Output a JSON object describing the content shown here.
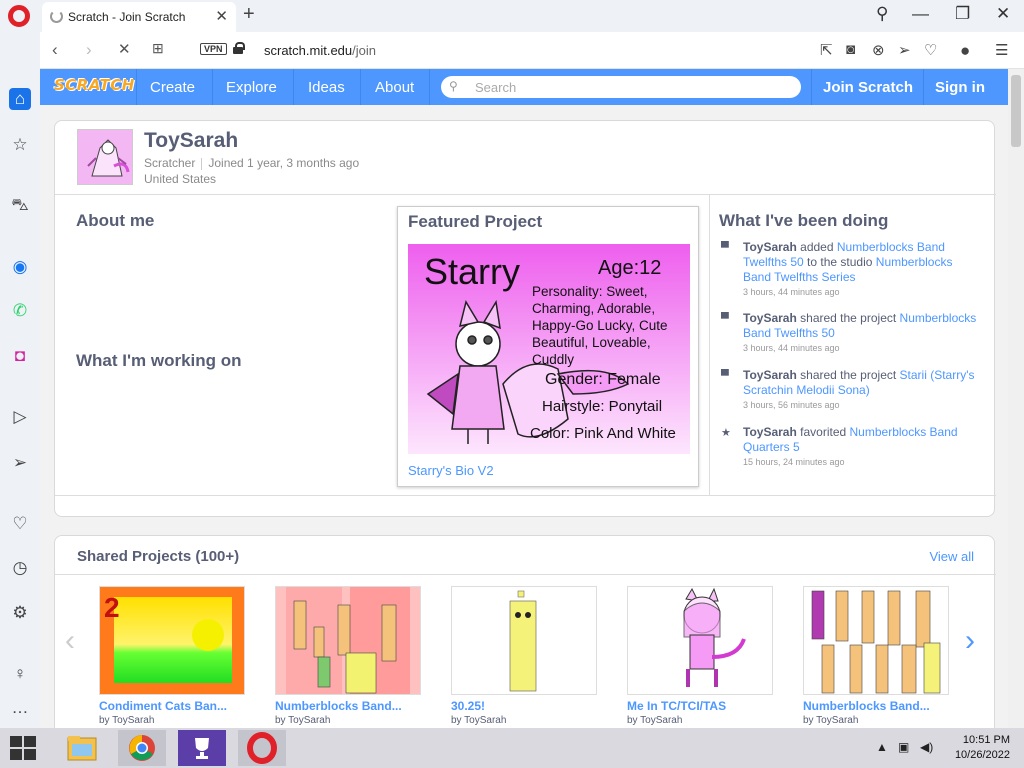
{
  "browser": {
    "tab_title": "Scratch - Join Scratch",
    "url_domain": "scratch.mit.edu",
    "url_path": "/join",
    "vpn_label": "VPN"
  },
  "scratch_nav": {
    "logo": "SCRATCH",
    "items": [
      "Create",
      "Explore",
      "Ideas",
      "About"
    ],
    "search_placeholder": "Search",
    "join": "Join Scratch",
    "signin": "Sign in"
  },
  "profile": {
    "username": "ToySarah",
    "role": "Scratcher",
    "joined": "Joined 1 year, 3 months ago",
    "country": "United States",
    "about_me_heading": "About me",
    "working_on_heading": "What I'm working on",
    "featured_heading": "Featured Project",
    "featured_title": "Starry's Bio V2",
    "featured_image": {
      "name": "Starry",
      "age": "Age:12",
      "personality": [
        "Personality: Sweet,",
        "Charming, Adorable,",
        "Happy-Go Lucky, Cute",
        "Beautiful, Loveable,",
        "Cuddly"
      ],
      "gender": "Gender: Female",
      "hairstyle": "Hairstyle: Ponytail",
      "color": "Color: Pink And White"
    },
    "activity_heading": "What I've been doing",
    "activity": [
      {
        "icon": "studio-icon",
        "user": "ToySarah",
        "verb": "added",
        "link1": "Numberblocks Band Twelfths 50",
        "mid": "to the studio",
        "link2": "Numberblocks Band Twelfths Series",
        "time": "3 hours, 44 minutes ago"
      },
      {
        "icon": "studio-icon",
        "user": "ToySarah",
        "verb": "shared the project",
        "link1": "Numberblocks Band Twelfths 50",
        "mid": "",
        "link2": "",
        "time": "3 hours, 44 minutes ago"
      },
      {
        "icon": "studio-icon",
        "user": "ToySarah",
        "verb": "shared the project",
        "link1": "Starii (Starry's Scratchin Melodii Sona)",
        "mid": "",
        "link2": "",
        "time": "3 hours, 56 minutes ago"
      },
      {
        "icon": "star-icon",
        "user": "ToySarah",
        "verb": "favorited",
        "link1": "Numberblocks Band Quarters 5",
        "mid": "",
        "link2": "",
        "time": "15 hours, 24 minutes ago"
      }
    ]
  },
  "shared": {
    "heading": "Shared Projects (100+)",
    "view_all": "View all",
    "projects": [
      {
        "title": "Condiment Cats Ban...",
        "by": "by ToySarah"
      },
      {
        "title": "Numberblocks Band...",
        "by": "by ToySarah"
      },
      {
        "title": "30.25!",
        "by": "by ToySarah"
      },
      {
        "title": "Me In TC/TCI/TAS",
        "by": "by ToySarah"
      },
      {
        "title": "Numberblocks Band...",
        "by": "by ToySarah"
      }
    ]
  },
  "taskbar": {
    "time": "10:51 PM",
    "date": "10/26/2022"
  },
  "colors": {
    "scratch_blue": "#4d97ff",
    "opera_red": "#e0212a",
    "text_gray": "#575e75"
  }
}
